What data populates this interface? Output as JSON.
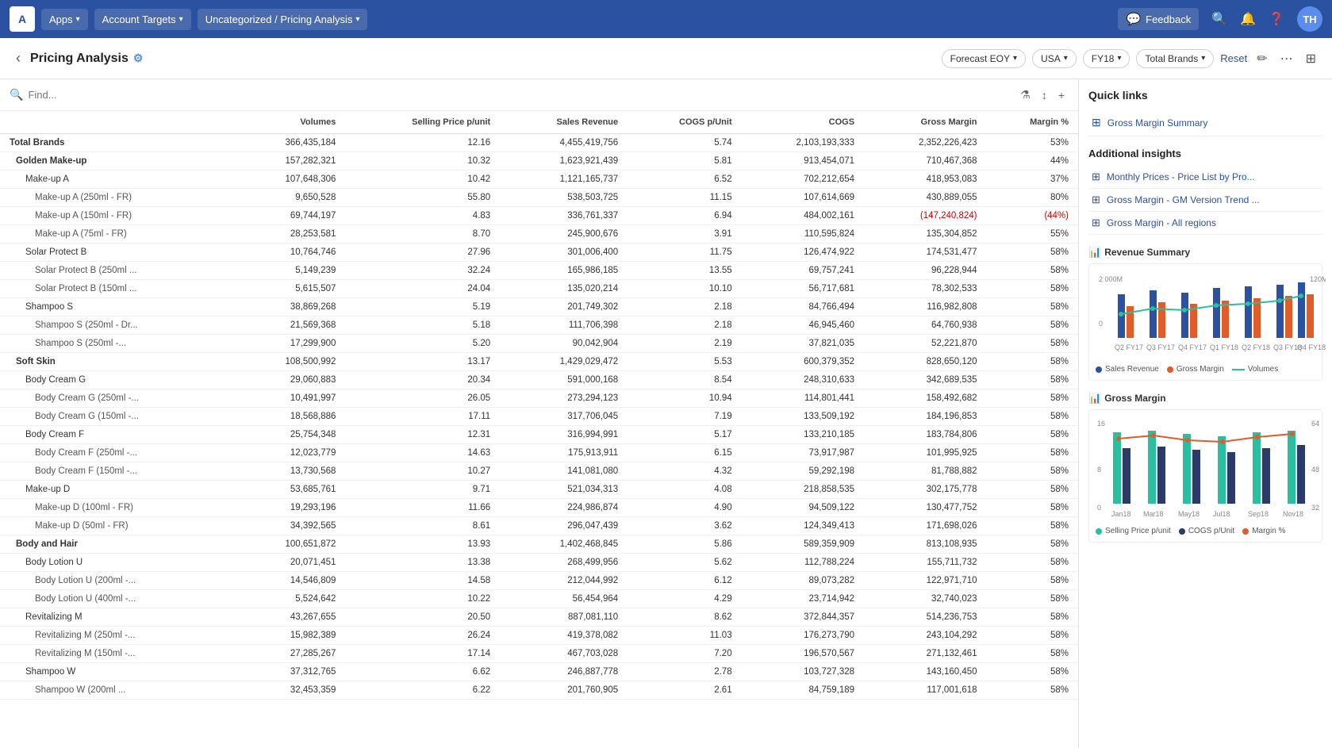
{
  "topNav": {
    "logo": "A",
    "apps_label": "Apps",
    "account_targets_label": "Account Targets",
    "breadcrumb_label": "Uncategorized / Pricing Analysis",
    "feedback_label": "Feedback",
    "avatar": "TH"
  },
  "secondBar": {
    "page_title": "Pricing Analysis",
    "filters": [
      {
        "label": "Forecast EOY",
        "key": "forecast"
      },
      {
        "label": "USA",
        "key": "usa"
      },
      {
        "label": "FY18",
        "key": "fy18"
      },
      {
        "label": "Total Brands",
        "key": "brands"
      }
    ],
    "reset_label": "Reset"
  },
  "table": {
    "columns": [
      "Volumes",
      "Selling Price p/unit",
      "Sales Revenue",
      "COGS p/Unit",
      "COGS",
      "Gross Margin",
      "Margin %"
    ],
    "rows": [
      {
        "name": "Total Brands",
        "level": 0,
        "values": [
          "366,435,184",
          "12.16",
          "4,455,419,756",
          "5.74",
          "2,103,193,333",
          "2,352,226,423",
          "53%"
        ]
      },
      {
        "name": "Golden Make-up",
        "level": 1,
        "values": [
          "157,282,321",
          "10.32",
          "1,623,921,439",
          "5.81",
          "913,454,071",
          "710,467,368",
          "44%"
        ]
      },
      {
        "name": "Make-up A",
        "level": 2,
        "values": [
          "107,648,306",
          "10.42",
          "1,121,165,737",
          "6.52",
          "702,212,654",
          "418,953,083",
          "37%"
        ]
      },
      {
        "name": "Make-up A (250ml - FR)",
        "level": 3,
        "values": [
          "9,650,528",
          "55.80",
          "538,503,725",
          "11.15",
          "107,614,669",
          "430,889,055",
          "80%"
        ]
      },
      {
        "name": "Make-up A (150ml - FR)",
        "level": 3,
        "values": [
          "69,744,197",
          "4.83",
          "336,761,337",
          "6.94",
          "484,002,161",
          "(147,240,824)",
          "(44%)"
        ],
        "negative": [
          false,
          false,
          false,
          false,
          false,
          true,
          true
        ]
      },
      {
        "name": "Make-up A (75ml - FR)",
        "level": 3,
        "values": [
          "28,253,581",
          "8.70",
          "245,900,676",
          "3.91",
          "110,595,824",
          "135,304,852",
          "55%"
        ]
      },
      {
        "name": "Solar Protect B",
        "level": 2,
        "values": [
          "10,764,746",
          "27.96",
          "301,006,400",
          "11.75",
          "126,474,922",
          "174,531,477",
          "58%"
        ]
      },
      {
        "name": "Solar Protect B (250ml ...",
        "level": 3,
        "values": [
          "5,149,239",
          "32.24",
          "165,986,185",
          "13.55",
          "69,757,241",
          "96,228,944",
          "58%"
        ]
      },
      {
        "name": "Solar Protect B (150ml ...",
        "level": 3,
        "values": [
          "5,615,507",
          "24.04",
          "135,020,214",
          "10.10",
          "56,717,681",
          "78,302,533",
          "58%"
        ]
      },
      {
        "name": "Shampoo S",
        "level": 2,
        "values": [
          "38,869,268",
          "5.19",
          "201,749,302",
          "2.18",
          "84,766,494",
          "116,982,808",
          "58%"
        ]
      },
      {
        "name": "Shampoo S (250ml - Dr...",
        "level": 3,
        "values": [
          "21,569,368",
          "5.18",
          "111,706,398",
          "2.18",
          "46,945,460",
          "64,760,938",
          "58%"
        ]
      },
      {
        "name": "Shampoo S (250ml -...",
        "level": 3,
        "values": [
          "17,299,900",
          "5.20",
          "90,042,904",
          "2.19",
          "37,821,035",
          "52,221,870",
          "58%"
        ]
      },
      {
        "name": "Soft Skin",
        "level": 1,
        "values": [
          "108,500,992",
          "13.17",
          "1,429,029,472",
          "5.53",
          "600,379,352",
          "828,650,120",
          "58%"
        ]
      },
      {
        "name": "Body Cream G",
        "level": 2,
        "values": [
          "29,060,883",
          "20.34",
          "591,000,168",
          "8.54",
          "248,310,633",
          "342,689,535",
          "58%"
        ]
      },
      {
        "name": "Body Cream G (250ml -...",
        "level": 3,
        "values": [
          "10,491,997",
          "26.05",
          "273,294,123",
          "10.94",
          "114,801,441",
          "158,492,682",
          "58%"
        ]
      },
      {
        "name": "Body Cream G (150ml -...",
        "level": 3,
        "values": [
          "18,568,886",
          "17.11",
          "317,706,045",
          "7.19",
          "133,509,192",
          "184,196,853",
          "58%"
        ]
      },
      {
        "name": "Body Cream F",
        "level": 2,
        "values": [
          "25,754,348",
          "12.31",
          "316,994,991",
          "5.17",
          "133,210,185",
          "183,784,806",
          "58%"
        ]
      },
      {
        "name": "Body Cream F (250ml -...",
        "level": 3,
        "values": [
          "12,023,779",
          "14.63",
          "175,913,911",
          "6.15",
          "73,917,987",
          "101,995,925",
          "58%"
        ]
      },
      {
        "name": "Body Cream F (150ml -...",
        "level": 3,
        "values": [
          "13,730,568",
          "10.27",
          "141,081,080",
          "4.32",
          "59,292,198",
          "81,788,882",
          "58%"
        ]
      },
      {
        "name": "Make-up D",
        "level": 2,
        "values": [
          "53,685,761",
          "9.71",
          "521,034,313",
          "4.08",
          "218,858,535",
          "302,175,778",
          "58%"
        ]
      },
      {
        "name": "Make-up D (100ml - FR)",
        "level": 3,
        "values": [
          "19,293,196",
          "11.66",
          "224,986,874",
          "4.90",
          "94,509,122",
          "130,477,752",
          "58%"
        ]
      },
      {
        "name": "Make-up D (50ml - FR)",
        "level": 3,
        "values": [
          "34,392,565",
          "8.61",
          "296,047,439",
          "3.62",
          "124,349,413",
          "171,698,026",
          "58%"
        ]
      },
      {
        "name": "Body and Hair",
        "level": 1,
        "values": [
          "100,651,872",
          "13.93",
          "1,402,468,845",
          "5.86",
          "589,359,909",
          "813,108,935",
          "58%"
        ]
      },
      {
        "name": "Body Lotion U",
        "level": 2,
        "values": [
          "20,071,451",
          "13.38",
          "268,499,956",
          "5.62",
          "112,788,224",
          "155,711,732",
          "58%"
        ]
      },
      {
        "name": "Body Lotion U (200ml -...",
        "level": 3,
        "values": [
          "14,546,809",
          "14.58",
          "212,044,992",
          "6.12",
          "89,073,282",
          "122,971,710",
          "58%"
        ]
      },
      {
        "name": "Body Lotion U (400ml -...",
        "level": 3,
        "values": [
          "5,524,642",
          "10.22",
          "56,454,964",
          "4.29",
          "23,714,942",
          "32,740,023",
          "58%"
        ]
      },
      {
        "name": "Revitalizing M",
        "level": 2,
        "values": [
          "43,267,655",
          "20.50",
          "887,081,110",
          "8.62",
          "372,844,357",
          "514,236,753",
          "58%"
        ]
      },
      {
        "name": "Revitalizing M (250ml -...",
        "level": 3,
        "values": [
          "15,982,389",
          "26.24",
          "419,378,082",
          "11.03",
          "176,273,790",
          "243,104,292",
          "58%"
        ]
      },
      {
        "name": "Revitalizing M (150ml -...",
        "level": 3,
        "values": [
          "27,285,267",
          "17.14",
          "467,703,028",
          "7.20",
          "196,570,567",
          "271,132,461",
          "58%"
        ]
      },
      {
        "name": "Shampoo W",
        "level": 2,
        "values": [
          "37,312,765",
          "6.62",
          "246,887,778",
          "2.78",
          "103,727,328",
          "143,160,450",
          "58%"
        ]
      },
      {
        "name": "Shampoo W (200ml ...",
        "level": 3,
        "values": [
          "32,453,359",
          "6.22",
          "201,760,905",
          "2.61",
          "84,759,189",
          "117,001,618",
          "58%"
        ]
      }
    ]
  },
  "quickLinks": {
    "title": "Quick links",
    "items": [
      {
        "label": "Gross Margin Summary",
        "icon": "grid-icon"
      }
    ]
  },
  "additionalInsights": {
    "title": "Additional insights",
    "items": [
      {
        "label": "Monthly Prices - Price List by Pro...",
        "icon": "grid-icon"
      },
      {
        "label": "Gross Margin - GM Version Trend ...",
        "icon": "grid-icon"
      },
      {
        "label": "Gross Margin - All regions",
        "icon": "grid-icon"
      }
    ]
  },
  "revenueSummaryChart": {
    "title": "Revenue Summary",
    "yAxisMax": "2 000M",
    "yAxisMin": "0",
    "rightAxisMax": "120M",
    "rightAxisMin": "0",
    "labels": [
      "Q2 FY17",
      "Q3 FY17",
      "Q4 FY17",
      "Q1 FY18",
      "Q2 FY18",
      "Q3 FY18",
      "Q4 FY18"
    ],
    "legend": [
      {
        "label": "Sales Revenue",
        "color": "#2a52a0",
        "type": "dot"
      },
      {
        "label": "Gross Margin",
        "color": "#e05c2a",
        "type": "dot"
      },
      {
        "label": "Volumes",
        "color": "#2abfa0",
        "type": "line"
      }
    ]
  },
  "grossMarginChart": {
    "title": "Gross Margin",
    "icon": "bar-chart-icon",
    "legend": [
      {
        "label": "Selling Price p/unit",
        "color": "#2abfa0"
      },
      {
        "label": "COGS p/Unit",
        "color": "#2a52a0"
      },
      {
        "label": "Margin %",
        "color": "#e05c2a"
      }
    ]
  }
}
